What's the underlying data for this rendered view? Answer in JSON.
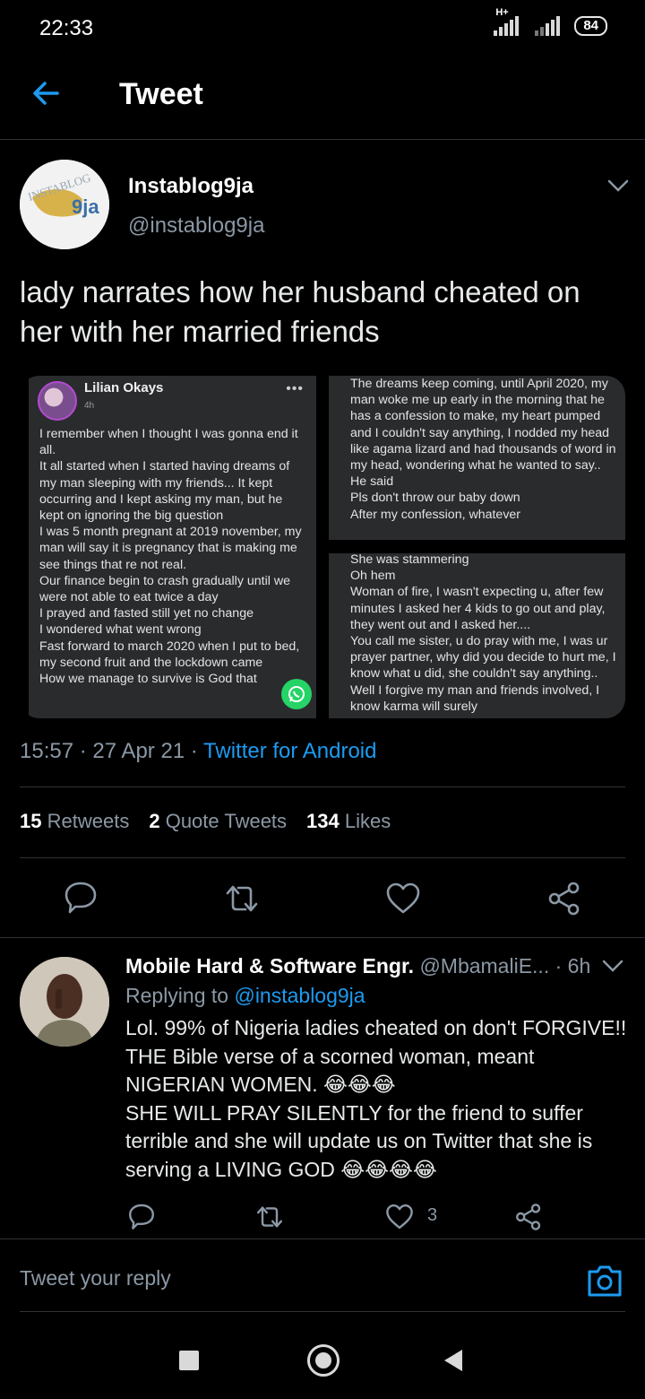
{
  "status_bar": {
    "time": "22:33",
    "network": "H+",
    "battery": "84"
  },
  "header": {
    "title": "Tweet"
  },
  "tweet": {
    "author_name": "Instablog9ja",
    "author_handle": "@instablog9ja",
    "text": "lady narrates how her husband cheated on her with her married friends",
    "media": {
      "left": {
        "poster": "Lilian Okays",
        "time": "4h",
        "body": "I remember when I thought I was gonna end it all.\nIt all started when I started having dreams of my man sleeping with my friends... It kept occurring and I kept asking my man, but he kept on ignoring the big question\nI was 5 month pregnant at 2019 november, my man will say it is pregnancy that is making me see things that re not real.\nOur finance begin to crash gradually until we were not able to eat twice a day\nI prayed and fasted still yet no change\nI wondered what went wrong\nFast forward to march 2020 when I put to bed, my second fruit and the lockdown came\nHow we manage to survive is God that"
      },
      "top_right": "The dreams keep coming, until April 2020, my man woke me up early in the morning that he has a confession to make, my heart pumped and I couldn't say anything, I nodded my head like agama lizard and had thousands of word in my head, wondering what he wanted to say.. He said\nPls don't throw our baby down\nAfter my confession, whatever",
      "bottom_right": "She was stammering\nOh hem\nWoman of fire,  I wasn't expecting u, after few minutes I asked her 4 kids to go out and play, they went out and I asked her....\nYou call me sister, u do pray with me, I was ur prayer partner, why did you decide to hurt me, I know what u did, she couldn't say anything.. Well I forgive my man and friends involved, I know karma will surely"
    },
    "time": "15:57",
    "date": "27 Apr 21",
    "source": "Twitter for Android",
    "retweets": "15",
    "retweets_label": "Retweets",
    "quotes": "2",
    "quotes_label": "Quote Tweets",
    "likes": "134",
    "likes_label": "Likes"
  },
  "reply": {
    "name": "Mobile Hard & Software Engr.",
    "handle": "@MbamaliE...",
    "time": "· 6h",
    "replying_prefix": "Replying to",
    "replying_to": "@instablog9ja",
    "text": "Lol. 99% of Nigeria ladies cheated on don't FORGIVE!!\nTHE Bible verse of a scorned woman, meant NIGERIAN WOMEN. 😂😂😂\nSHE WILL PRAY SILENTLY for the friend to suffer terrible and she will update us on Twitter that she is serving a LIVING GOD 😂😂😂😂",
    "likes": "3"
  },
  "compose": {
    "placeholder": "Tweet your reply"
  },
  "colors": {
    "accent": "#1d9bf0",
    "muted": "#8b98a5",
    "background": "#000000",
    "divider": "#2f3336"
  },
  "icons": [
    "back-arrow-icon",
    "chevron-down-icon",
    "reply-icon",
    "retweet-icon",
    "like-icon",
    "share-icon",
    "camera-icon",
    "whatsapp-icon"
  ]
}
